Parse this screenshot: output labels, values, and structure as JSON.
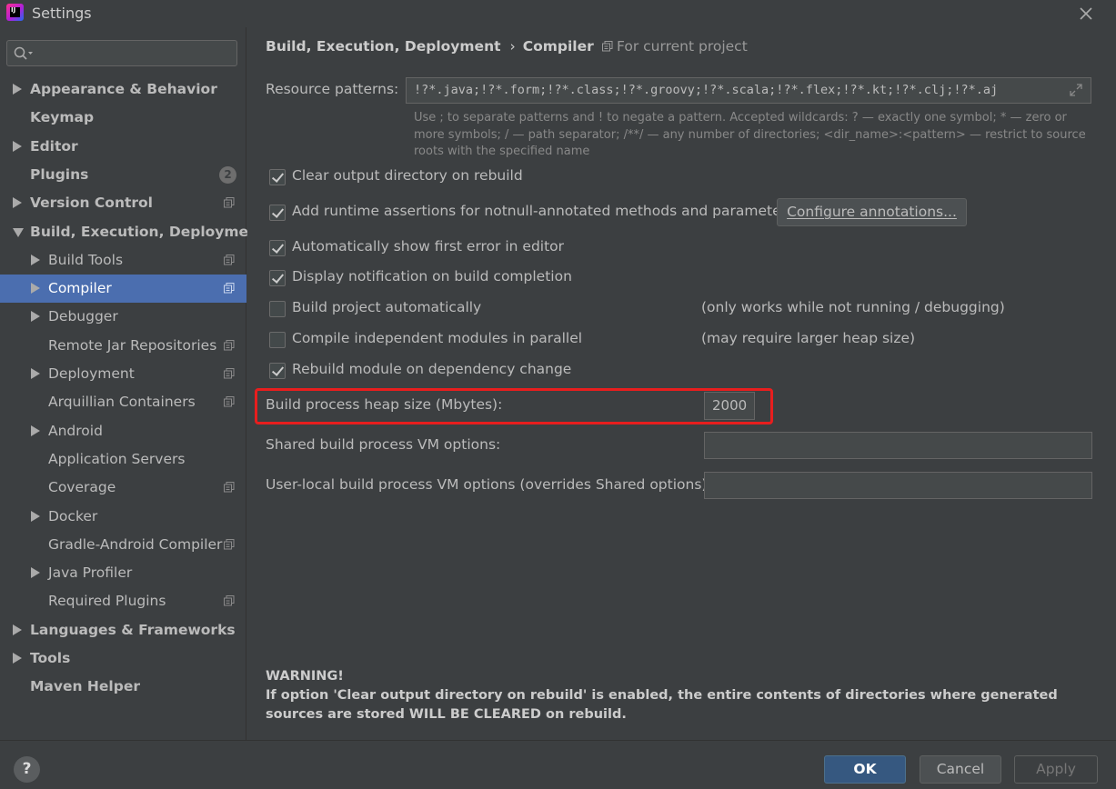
{
  "window": {
    "title": "Settings"
  },
  "search": {
    "placeholder": ""
  },
  "nav": [
    {
      "label": "Appearance & Behavior",
      "level": 0,
      "arrow": "right",
      "bold": true
    },
    {
      "label": "Keymap",
      "level": 0,
      "arrow": "",
      "bold": true
    },
    {
      "label": "Editor",
      "level": 0,
      "arrow": "right",
      "bold": true
    },
    {
      "label": "Plugins",
      "level": 0,
      "arrow": "",
      "bold": true,
      "badge": "2"
    },
    {
      "label": "Version Control",
      "level": 0,
      "arrow": "right",
      "bold": true,
      "project_icon": true
    },
    {
      "label": "Build, Execution, Deployment",
      "level": 0,
      "arrow": "down",
      "bold": true
    },
    {
      "label": "Build Tools",
      "level": 1,
      "arrow": "right",
      "project_icon": true
    },
    {
      "label": "Compiler",
      "level": 1,
      "arrow": "right",
      "project_icon": true,
      "selected": true
    },
    {
      "label": "Debugger",
      "level": 1,
      "arrow": "right"
    },
    {
      "label": "Remote Jar Repositories",
      "level": 1,
      "arrow": "",
      "project_icon": true
    },
    {
      "label": "Deployment",
      "level": 1,
      "arrow": "right",
      "project_icon": true
    },
    {
      "label": "Arquillian Containers",
      "level": 1,
      "arrow": "",
      "project_icon": true
    },
    {
      "label": "Android",
      "level": 1,
      "arrow": "right"
    },
    {
      "label": "Application Servers",
      "level": 1,
      "arrow": ""
    },
    {
      "label": "Coverage",
      "level": 1,
      "arrow": "",
      "project_icon": true
    },
    {
      "label": "Docker",
      "level": 1,
      "arrow": "right"
    },
    {
      "label": "Gradle-Android Compiler",
      "level": 1,
      "arrow": "",
      "project_icon": true
    },
    {
      "label": "Java Profiler",
      "level": 1,
      "arrow": "right"
    },
    {
      "label": "Required Plugins",
      "level": 1,
      "arrow": "",
      "project_icon": true
    },
    {
      "label": "Languages & Frameworks",
      "level": 0,
      "arrow": "right",
      "bold": true
    },
    {
      "label": "Tools",
      "level": 0,
      "arrow": "right",
      "bold": true
    },
    {
      "label": "Maven Helper",
      "level": 0,
      "arrow": "",
      "bold": true
    }
  ],
  "breadcrumb": {
    "parent": "Build, Execution, Deployment",
    "separator": "›",
    "current": "Compiler"
  },
  "scope": {
    "label": "For current project"
  },
  "resource_patterns": {
    "label": "Resource patterns:",
    "value": "!?*.java;!?*.form;!?*.class;!?*.groovy;!?*.scala;!?*.flex;!?*.kt;!?*.clj;!?*.aj",
    "hint": "Use ; to separate patterns and ! to negate a pattern. Accepted wildcards: ? — exactly one symbol; * — zero or more symbols; / — path separator; /**/ — any number of directories; <dir_name>:<pattern> — restrict to source roots with the specified name"
  },
  "options": [
    {
      "label": "Clear output directory on rebuild",
      "checked": true,
      "note": ""
    },
    {
      "label": "Add runtime assertions for notnull-annotated methods and parameters",
      "checked": true,
      "note": ""
    },
    {
      "label": "Automatically show first error in editor",
      "checked": true,
      "note": ""
    },
    {
      "label": "Display notification on build completion",
      "checked": true,
      "note": ""
    },
    {
      "label": "Build project automatically",
      "checked": false,
      "note": "(only works while not running / debugging)"
    },
    {
      "label": "Compile independent modules in parallel",
      "checked": false,
      "note": "(may require larger heap size)"
    },
    {
      "label": "Rebuild module on dependency change",
      "checked": true,
      "note": ""
    }
  ],
  "configure_annotations": {
    "label": "Configure annotations..."
  },
  "heap_size": {
    "label": "Build process heap size (Mbytes):",
    "value": "2000"
  },
  "shared_vm": {
    "label": "Shared build process VM options:",
    "value": ""
  },
  "user_local_vm": {
    "label": "User-local build process VM options (overrides Shared options):",
    "value": ""
  },
  "warning": {
    "title": "WARNING!",
    "text": "If option 'Clear output directory on rebuild' is enabled, the entire contents of directories where generated sources are stored WILL BE CLEARED on rebuild."
  },
  "footer": {
    "help": "?",
    "ok": "OK",
    "cancel": "Cancel",
    "apply": "Apply"
  },
  "colors": {
    "accent_selection": "#4b6eaf",
    "highlight_box": "#e81e1e",
    "ok_button": "#365880"
  }
}
